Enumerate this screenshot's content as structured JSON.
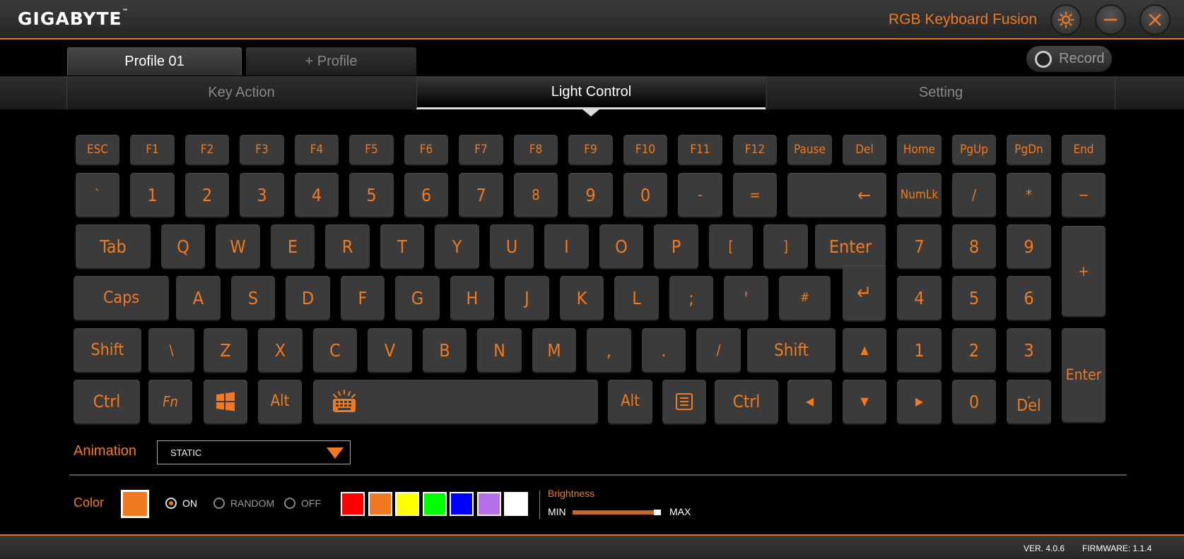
{
  "brand": "GIGABYTE",
  "brand_mark": "™",
  "app_title": "RGB Keyboard Fusion",
  "profiles": {
    "active": "Profile 01",
    "add": "+ Profile"
  },
  "record_label": "Record",
  "tabs": {
    "key_action": "Key Action",
    "light_control": "Light Control",
    "setting": "Setting"
  },
  "keys": {
    "esc": "ESC",
    "f1": "F1",
    "f2": "F2",
    "f3": "F3",
    "f4": "F4",
    "f5": "F5",
    "f6": "F6",
    "f7": "F7",
    "f8": "F8",
    "f9": "F9",
    "f10": "F10",
    "f11": "F11",
    "f12": "F12",
    "pause": "Pause",
    "del": "Del",
    "home": "Home",
    "pgup": "PgUp",
    "pgdn": "PgDn",
    "end": "End",
    "backtick": "`",
    "n1": "1",
    "n2": "2",
    "n3": "3",
    "n4": "4",
    "n5": "5",
    "n6": "6",
    "n7": "7",
    "n8": "8",
    "n9": "9",
    "n0": "0",
    "minus": "-",
    "equals": "=",
    "backspace": "←",
    "numlk": "NumLk",
    "np_slash": "/",
    "np_star": "*",
    "np_minus": "−",
    "tab": "Tab",
    "q": "Q",
    "w": "W",
    "e": "E",
    "r": "R",
    "t": "T",
    "y": "Y",
    "u": "U",
    "i": "I",
    "o": "O",
    "p": "P",
    "lbracket": "[",
    "rbracket": "]",
    "enter": "Enter",
    "np7": "7",
    "np8": "8",
    "np9": "9",
    "np_plus": "+",
    "caps": "Caps",
    "a": "A",
    "s": "S",
    "d": "D",
    "f": "F",
    "g": "G",
    "h": "H",
    "j": "J",
    "k": "K",
    "l": "L",
    "semicolon": ";",
    "quote": "'",
    "hash": "#",
    "enter_arrow": "↵",
    "np4": "4",
    "np5": "5",
    "np6": "6",
    "lshift": "Shift",
    "backslash": "\\",
    "z": "Z",
    "x": "X",
    "c": "C",
    "v": "V",
    "b": "B",
    "n": "N",
    "m": "M",
    "comma": ",",
    "period": ".",
    "slash": "/",
    "rshift": "Shift",
    "up": "▲",
    "np1": "1",
    "np2": "2",
    "np3": "3",
    "np_enter": "Enter",
    "lctrl": "Ctrl",
    "fn": "Fn",
    "win": "windows-icon",
    "lalt": "Alt",
    "space": "keyboard-backlight-icon",
    "ralt": "Alt",
    "menu": "menu-icon",
    "rctrl": "Ctrl",
    "left": "◀",
    "down": "▼",
    "right": "▶",
    "np0": "0",
    "np_dot": ".",
    "np_del": "Del"
  },
  "animation": {
    "label": "Animation",
    "value": "STATIC"
  },
  "color": {
    "label": "Color",
    "current": "#f07a21",
    "on": "ON",
    "random": "RANDOM",
    "off": "OFF",
    "selected_mode": "ON",
    "swatches": [
      "#ff0000",
      "#f07a21",
      "#ffff00",
      "#00ff00",
      "#0000ff",
      "#b56ee8",
      "#ffffff"
    ]
  },
  "brightness": {
    "label": "Brightness",
    "min": "MIN",
    "max": "MAX",
    "level": 0.95
  },
  "footer": {
    "version": "VER. 4.0.6",
    "firmware": "FIRMWARE: 1.1.4"
  },
  "accent": "#f07a21"
}
